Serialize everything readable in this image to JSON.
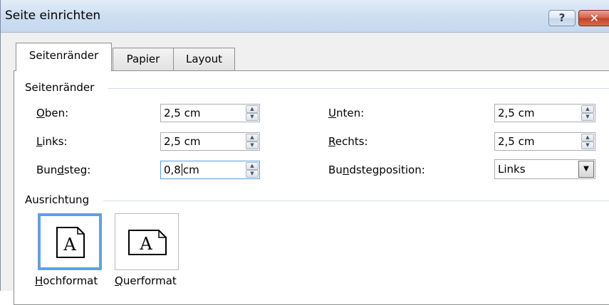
{
  "window": {
    "title": "Seite einrichten",
    "help_label": "?",
    "close_label": "✕"
  },
  "tabs": [
    {
      "label": "Seitenränder",
      "active": true
    },
    {
      "label": "Papier",
      "active": false
    },
    {
      "label": "Layout",
      "active": false
    }
  ],
  "margins": {
    "group_label": "Seitenränder",
    "top": {
      "label_ul": "O",
      "label_rest": "ben:",
      "value": "2,5 cm"
    },
    "left": {
      "label_ul": "L",
      "label_rest": "inks:",
      "value": "2,5 cm"
    },
    "gutter": {
      "label_pre": "Bun",
      "label_ul": "d",
      "label_rest": "steg:",
      "value_before_caret": "0,8",
      "value_after_caret": "cm"
    },
    "bottom": {
      "label_ul": "U",
      "label_rest": "nten:",
      "value": "2,5 cm"
    },
    "right": {
      "label_ul": "R",
      "label_rest": "echts:",
      "value": "2,5 cm"
    },
    "gutter_position": {
      "label_pre": "Bu",
      "label_ul": "n",
      "label_rest": "dstegposition:",
      "value": "Links"
    }
  },
  "orientation": {
    "group_label": "Ausrichtung",
    "portrait": {
      "label_ul": "H",
      "label_rest": "ochformat",
      "glyph": "A",
      "selected": true
    },
    "landscape": {
      "label_ul": "Q",
      "label_rest": "uerformat",
      "glyph": "A",
      "selected": false
    }
  },
  "icons": {
    "spin_up": "spin-up-icon",
    "spin_down": "spin-down-icon",
    "dropdown": "chevron-down-icon",
    "portrait": "portrait-page-icon",
    "landscape": "landscape-page-icon"
  },
  "colors": {
    "selection_blue": "#5aa3e8",
    "close_red": "#c2412a"
  }
}
